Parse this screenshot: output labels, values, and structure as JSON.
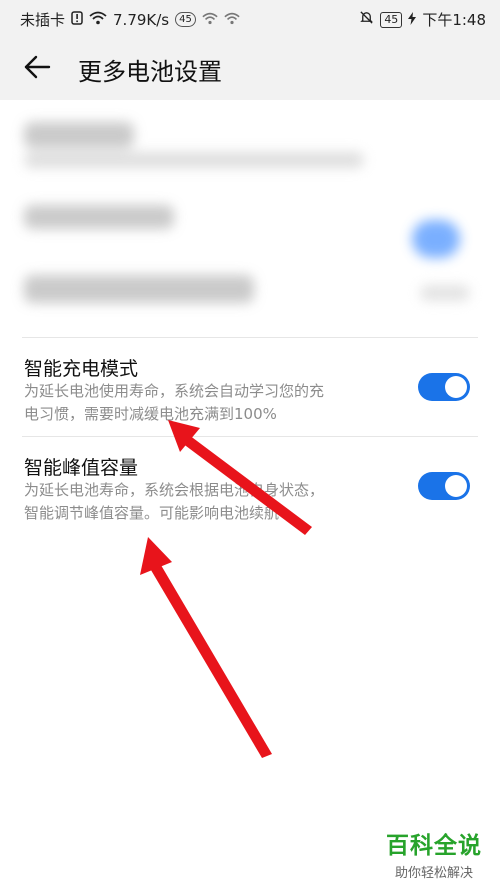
{
  "status_bar": {
    "carrier": "未插卡",
    "speed": "7.79K/s",
    "network_badge": "45",
    "battery": "45",
    "time": "下午1:48"
  },
  "header": {
    "title": "更多电池设置",
    "back_icon": "arrow-left-icon"
  },
  "settings": [
    {
      "title": "智能充电模式",
      "description_lines": [
        "为延长电池使用寿命，系统会自动学习您的充",
        "电习惯，需要时减缓电池充满到100%"
      ],
      "enabled": true
    },
    {
      "title": "智能峰值容量",
      "description_lines": [
        "为延长电池寿命，系统会根据电池自身状态，",
        "智能调节峰值容量。可能影响电池续航"
      ],
      "enabled": true
    }
  ],
  "watermark": {
    "title": "百科全说",
    "subtitle": "助你轻松解决"
  },
  "colors": {
    "toggle_on": "#1a73e8",
    "annotation_arrow": "#e8141b",
    "watermark_green": "#27a32b"
  }
}
